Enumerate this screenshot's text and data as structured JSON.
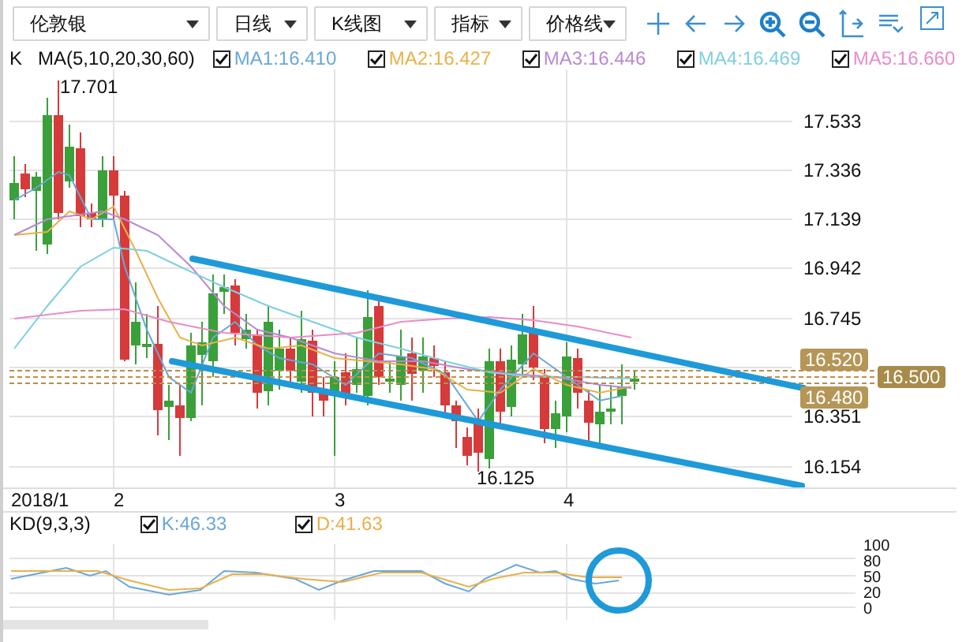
{
  "toolbar": {
    "dropdowns": [
      {
        "label": "伦敦银"
      },
      {
        "label": "日线"
      },
      {
        "label": "K线图"
      },
      {
        "label": "指标"
      },
      {
        "label": "价格线"
      }
    ]
  },
  "legend": {
    "label": "K",
    "formula": "MA(5,10,20,30,60)",
    "items": [
      {
        "label": "MA1:16.410",
        "checked": true,
        "color": "#6aa7d6"
      },
      {
        "label": "MA2:16.427",
        "checked": true,
        "color": "#e8b14a"
      },
      {
        "label": "MA3:16.446",
        "checked": true,
        "color": "#b88ad0"
      },
      {
        "label": "MA4:16.469",
        "checked": true,
        "color": "#7ecfe0"
      },
      {
        "label": "MA5:16.660",
        "checked": true,
        "color": "#e88cc8"
      }
    ]
  },
  "price_chart": {
    "high_label": "17.701",
    "low_label": "16.125",
    "y_ticks": [
      "17.533",
      "17.336",
      "17.139",
      "16.942",
      "16.745",
      "16.351",
      "16.154"
    ],
    "price_tags": [
      {
        "value": "16.520",
        "kind": "line"
      },
      {
        "value": "16.500",
        "kind": "axis"
      },
      {
        "value": "16.480",
        "kind": "line"
      }
    ],
    "x_labels": [
      "2018/1",
      "2",
      "3",
      "4"
    ]
  },
  "indicator": {
    "label": "KD(9,3,3)",
    "items": [
      {
        "label": "K:46.33",
        "checked": true,
        "color": "#6aa7d6"
      },
      {
        "label": "D:41.63",
        "checked": true,
        "color": "#e8b14a"
      }
    ],
    "y_ticks": [
      "100",
      "80",
      "50",
      "20",
      "0"
    ]
  }
}
